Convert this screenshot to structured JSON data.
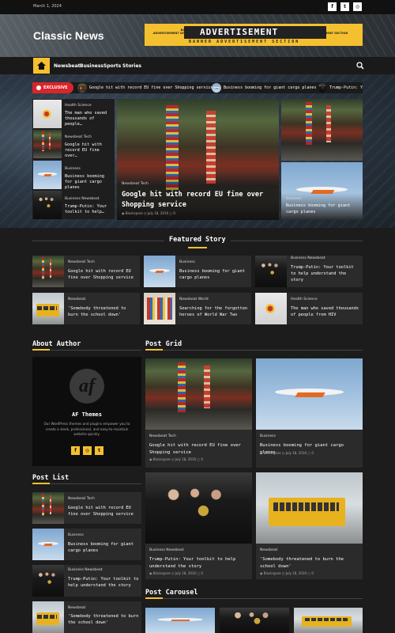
{
  "topbar": {
    "date": "March 1, 2024",
    "social": [
      "f",
      "t",
      "ig"
    ]
  },
  "header": {
    "logo": "Classic News",
    "ad": {
      "small_left": "BANNER\nADVERTISEMENT SECTION",
      "big": "ADVERTISEMENT",
      "small_right": "BANNER\nADVERTISEMENT SECTION",
      "sub": "BANNER ADVERTISEMENT SECTION"
    }
  },
  "nav": {
    "items": [
      "Newsbeat",
      "Business",
      "Sports",
      "Stories"
    ]
  },
  "ticker": {
    "label": "EXCLUSIVE",
    "items": [
      "Google hit with record EU fine over Shopping service",
      "Business booming for giant cargo planes",
      "Trump-Putin: Y"
    ]
  },
  "hero": {
    "side": [
      {
        "cat": "Health Science",
        "title": "The man who saved thousands of people…"
      },
      {
        "cat": "Newsbeat Tech",
        "title": "Google hit with record EU fine over…"
      },
      {
        "cat": "Business",
        "title": "Business booming for giant cargo planes"
      },
      {
        "cat": "Business Newsbeat",
        "title": "Trump-Putin: Your toolkit to help…"
      }
    ],
    "main": {
      "cat": "Newsbeat Tech",
      "title": "Google hit with record EU fine over Shopping service",
      "author": "Blockspare",
      "date": "July 18, 2016",
      "comments": "0"
    },
    "right": {
      "cat": "Business",
      "title": "Business booming for giant cargo planes"
    }
  },
  "featured": {
    "heading": "Featured Story",
    "cards": [
      {
        "cat": "Newsbeat Tech",
        "title": "Google hit with record EU fine over Shopping service"
      },
      {
        "cat": "Business",
        "title": "Business booming for giant cargo planes"
      },
      {
        "cat": "Business Newsbeat",
        "title": "Trump-Putin: Your toolkit to help understand the story"
      },
      {
        "cat": "Newsbeat",
        "title": "'Somebody threatened to burn the school down'"
      },
      {
        "cat": "Newsbeat World",
        "title": "Searching for the forgotten heroes of World War Two"
      },
      {
        "cat": "Health Science",
        "title": "The man who saved thousands of people from HIV"
      }
    ]
  },
  "about": {
    "heading": "About Author",
    "logo": "af",
    "name": "AF Themes",
    "desc": "Our WordPress themes and plugins empower you to create a sleek, professional, and easy-to-maintain website quickly.",
    "social": [
      "f",
      "ig",
      "t"
    ]
  },
  "postlist": {
    "heading": "Post List",
    "items": [
      {
        "cat": "Newsbeat Tech",
        "title": "Google hit with record EU fine over Shopping service"
      },
      {
        "cat": "Business",
        "title": "Business booming for giant cargo planes"
      },
      {
        "cat": "Business Newsbeat",
        "title": "Trump-Putin: Your toolkit to help understand the story"
      },
      {
        "cat": "Newsbeat",
        "title": "'Somebody threatened to burn the school down'"
      }
    ]
  },
  "postgrid": {
    "heading": "Post Grid",
    "items": [
      {
        "cat": "Newsbeat Tech",
        "title": "Google hit with record EU fine over Shopping service",
        "author": "Blockspare",
        "date": "July 18, 2016",
        "comments": "0"
      },
      {
        "cat": "Business",
        "title": "Business booming for giant cargo planes",
        "author": "Blockspare",
        "date": "July 18, 2016",
        "comments": "0"
      },
      {
        "cat": "Business Newsbeat",
        "title": "Trump-Putin: Your toolkit to help understand the story",
        "author": "Blockspare",
        "date": "July 18, 2016",
        "comments": "0"
      },
      {
        "cat": "Newsbeat",
        "title": "'Somebody threatened to burn the school down'",
        "author": "Blockspare",
        "date": "July 18, 2016",
        "comments": "0"
      }
    ]
  },
  "carousel": {
    "heading": "Post Carousel"
  },
  "colors": {
    "accent": "#f5c02f",
    "ticker_red": "#d8262b",
    "bg": "#1c1c1c",
    "card": "#2b2b2b"
  }
}
